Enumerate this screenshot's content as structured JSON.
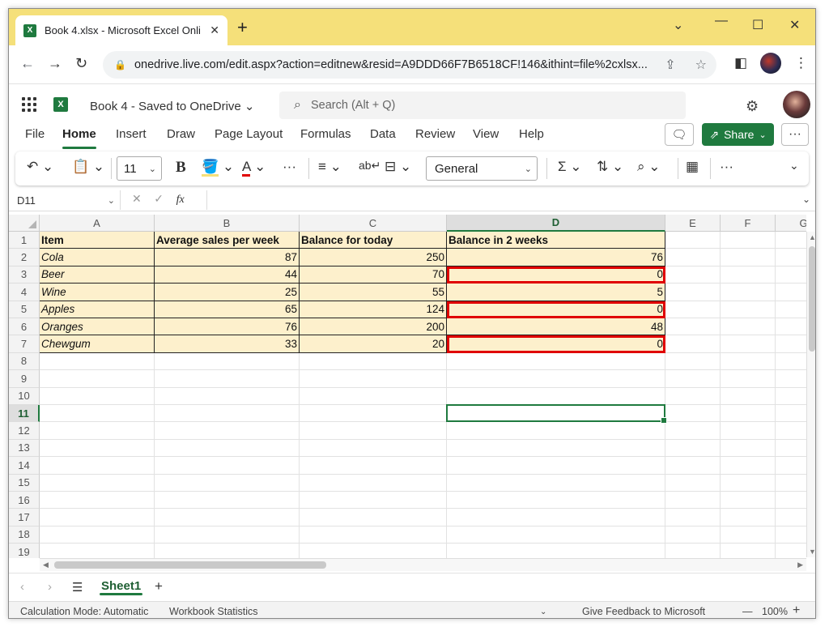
{
  "browser": {
    "tab_title": "Book 4.xlsx - Microsoft Excel Onli",
    "tab_close": "✕",
    "new_tab": "+",
    "url": "onedrive.live.com/edit.aspx?action=editnew&resid=A9DDD66F7B6518CF!146&ithint=file%2cxlsx..."
  },
  "office": {
    "doc_title": "Book 4 - Saved to OneDrive",
    "search_placeholder": "Search (Alt + Q)",
    "ribbon_tabs": [
      "File",
      "Home",
      "Insert",
      "Draw",
      "Page Layout",
      "Formulas",
      "Data",
      "Review",
      "View",
      "Help"
    ],
    "active_tab": "Home",
    "share_label": "Share",
    "font_size": "11",
    "number_format": "General"
  },
  "formula_bar": {
    "name_box": "D11",
    "fx": "fx",
    "content": ""
  },
  "sheet": {
    "columns": [
      "A",
      "B",
      "C",
      "D",
      "E",
      "F",
      "G"
    ],
    "rows": [
      "1",
      "2",
      "3",
      "4",
      "5",
      "6",
      "7",
      "8",
      "9",
      "10",
      "11",
      "12",
      "13",
      "14",
      "15",
      "16",
      "17",
      "18",
      "19"
    ],
    "selected_column": "D",
    "selected_row": "11",
    "headers": [
      "Item",
      "Average sales per week",
      "Balance for today",
      "Balance in 2 weeks"
    ],
    "data": [
      [
        "Cola",
        "87",
        "250",
        "76"
      ],
      [
        "Beer",
        "44",
        "70",
        "0"
      ],
      [
        "Wine",
        "25",
        "55",
        "5"
      ],
      [
        "Apples",
        "65",
        "124",
        "0"
      ],
      [
        "Oranges",
        "76",
        "200",
        "48"
      ],
      [
        "Chewgum",
        "33",
        "20",
        "0"
      ]
    ],
    "highlighted_rows": [
      2,
      4,
      6
    ],
    "colors": {
      "data_fill": "#fdf0cc",
      "highlight": "#e00000",
      "accent": "#1f7a3f"
    }
  },
  "sheet_tabs": {
    "active": "Sheet1",
    "add": "+"
  },
  "status": {
    "calc_mode": "Calculation Mode: Automatic",
    "workbook_stats": "Workbook Statistics",
    "feedback": "Give Feedback to Microsoft",
    "zoom": "100%"
  }
}
